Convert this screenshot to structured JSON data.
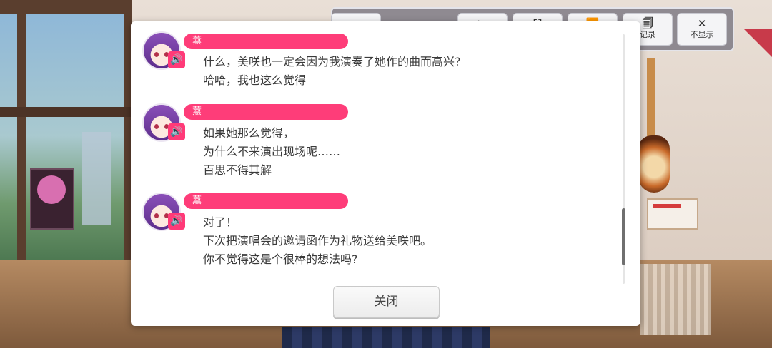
{
  "toolbar": {
    "buttons": [
      {
        "icon": "fast-forward-icon",
        "glyph": "⏭",
        "label": ""
      },
      {
        "icon": "play-icon",
        "glyph": "▶",
        "label": ""
      },
      {
        "icon": "fit-icon",
        "glyph": "⛶",
        "label": ""
      },
      {
        "icon": "skip-icon",
        "glyph": "⏩",
        "label": ""
      },
      {
        "icon": "log-icon",
        "glyph": "🗐",
        "label": "记录"
      },
      {
        "icon": "close-icon",
        "glyph": "✕",
        "label": "不显示"
      }
    ]
  },
  "dialog_log": {
    "entries": [
      {
        "speaker": "薰",
        "lines": [
          "什么，美咲也一定会因为我演奏了她作的曲而高兴?",
          "哈哈，我也这么觉得"
        ]
      },
      {
        "speaker": "薰",
        "lines": [
          "如果她那么觉得，",
          "为什么不来演出现场呢……",
          "百思不得其解"
        ]
      },
      {
        "speaker": "薰",
        "lines": [
          "对了！",
          "下次把演唱会的邀请函作为礼物送给美咲吧。",
          "你不觉得这是个很棒的想法吗?"
        ]
      }
    ],
    "speaker_icon": "speaker-icon",
    "close_label": "关闭",
    "scroll_position": 0.85
  },
  "colors": {
    "name_bar": "#fe3d79",
    "text": "#3a3a3a"
  }
}
